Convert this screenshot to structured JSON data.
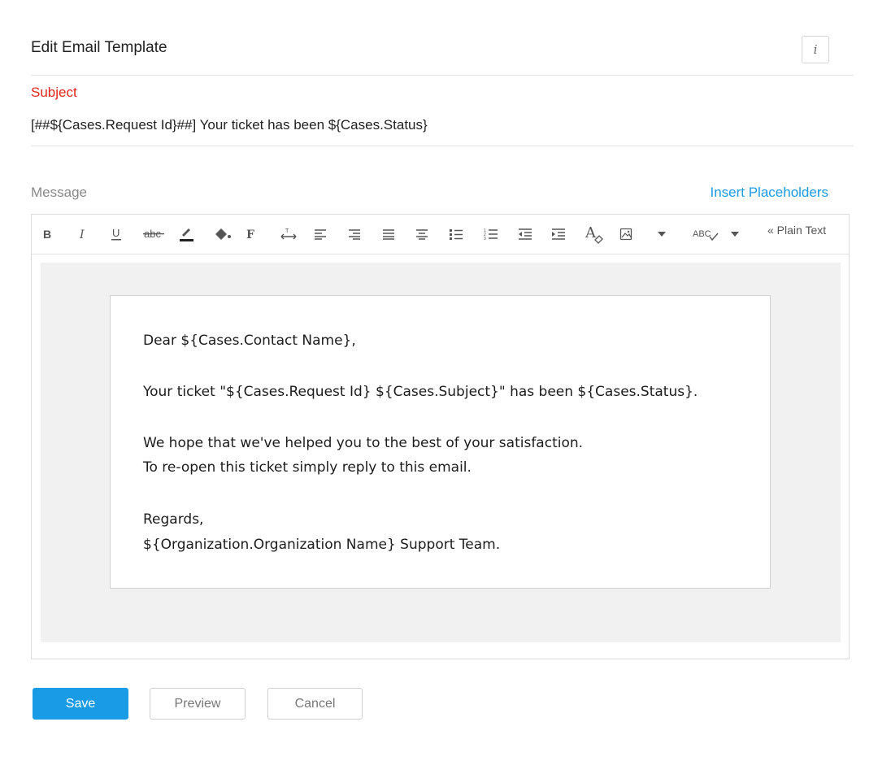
{
  "header": {
    "title": "Edit Email Template",
    "info_glyph": "i"
  },
  "subject": {
    "label": "Subject",
    "value": "[##${Cases.Request Id}##] Your ticket has been ${Cases.Status}"
  },
  "message": {
    "label": "Message",
    "insert_link": "Insert Placeholders",
    "toolbar": {
      "plain_text": "« Plain Text",
      "icons": [
        "bold-icon",
        "italic-icon",
        "underline-icon",
        "strikethrough-icon",
        "text-color-icon",
        "background-color-icon",
        "font-icon",
        "line-height-icon",
        "align-left-icon",
        "align-right-icon",
        "justify-icon",
        "align-center-icon",
        "bullet-list-icon",
        "numbered-list-icon",
        "outdent-icon",
        "indent-icon",
        "clear-format-icon",
        "image-icon",
        "dropdown-icon",
        "spellcheck-icon",
        "dropdown-icon"
      ]
    },
    "body_lines": [
      "Dear ${Cases.Contact Name},",
      "Your ticket \"${Cases.Request Id} ${Cases.Subject}\" has been ${Cases.Status}.",
      "We hope that we've helped you to the best of your satisfaction.",
      "To re-open this ticket simply reply to this email.",
      "Regards,",
      "${Organization.Organization Name} Support Team."
    ]
  },
  "buttons": {
    "save": "Save",
    "preview": "Preview",
    "cancel": "Cancel"
  },
  "colors": {
    "accent": "#1a9be6",
    "subject_label": "#e3241b",
    "canvas_bg": "#f1f1f1"
  }
}
